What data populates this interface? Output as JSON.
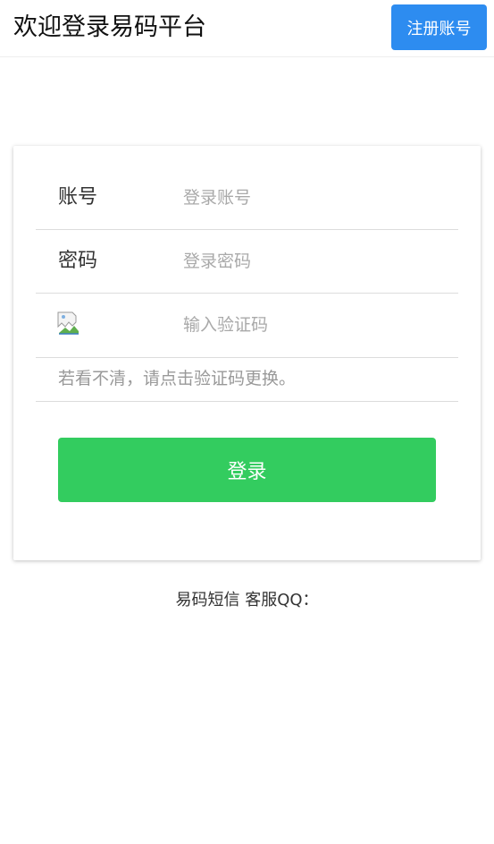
{
  "header": {
    "title": "欢迎登录易码平台",
    "register_label": "注册账号"
  },
  "form": {
    "account_label": "账号",
    "account_placeholder": "登录账号",
    "password_label": "密码",
    "password_placeholder": "登录密码",
    "captcha_placeholder": "输入验证码",
    "captcha_hint": "若看不清，请点击验证码更换。",
    "login_label": "登录"
  },
  "footer": {
    "text": "易码短信 客服QQ："
  },
  "colors": {
    "register_button": "#2d8cf0",
    "login_button": "#33cc5f"
  },
  "icons": {
    "captcha": "broken-image-icon"
  }
}
